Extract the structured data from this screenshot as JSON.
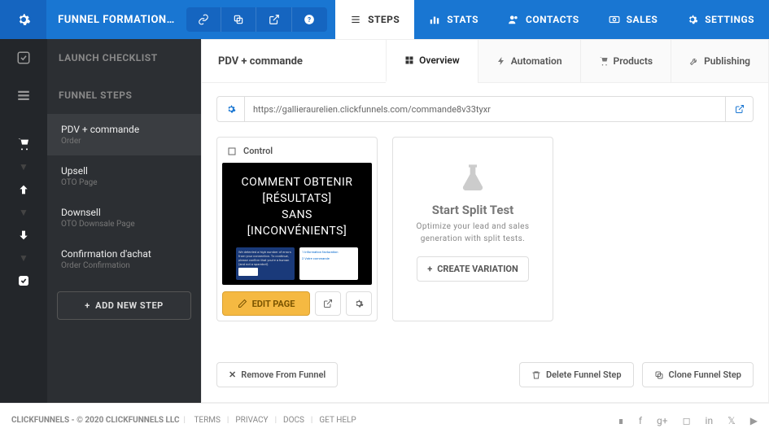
{
  "header": {
    "funnel_name": "FUNNEL FORMATION E…",
    "nav": [
      {
        "key": "steps",
        "label": "STEPS",
        "active": true
      },
      {
        "key": "stats",
        "label": "STATS"
      },
      {
        "key": "contacts",
        "label": "CONTACTS"
      },
      {
        "key": "sales",
        "label": "SALES"
      },
      {
        "key": "settings",
        "label": "SETTINGS"
      }
    ]
  },
  "sidebar": {
    "section_launch": "LAUNCH CHECKLIST",
    "section_steps": "FUNNEL STEPS",
    "steps": [
      {
        "name": "PDV + commande",
        "type": "Order",
        "active": true
      },
      {
        "name": "Upsell",
        "type": "OTO Page"
      },
      {
        "name": "Downsell",
        "type": "OTO Downsale Page"
      },
      {
        "name": "Confirmation d'achat",
        "type": "Order Confirmation"
      }
    ],
    "add_step": "ADD NEW STEP"
  },
  "content": {
    "title": "PDV + commande",
    "subtabs": [
      {
        "key": "overview",
        "label": "Overview",
        "active": true
      },
      {
        "key": "automation",
        "label": "Automation"
      },
      {
        "key": "products",
        "label": "Products"
      },
      {
        "key": "publishing",
        "label": "Publishing"
      }
    ],
    "url": "https://gallieraurelien.clickfunnels.com/commande8v33tyxr",
    "control_card": {
      "header": "Control",
      "preview_line1": "COMMENT OBTENIR",
      "preview_line2": "[RÉSULTATS]",
      "preview_line3": "SANS [INCONVÉNIENTS]",
      "edit_button": "EDIT PAGE"
    },
    "split_test": {
      "title": "Start Split Test",
      "subtitle": "Optimize your lead and sales generation with split tests.",
      "button": "CREATE VARIATION"
    },
    "bottom": {
      "remove": "Remove From Funnel",
      "delete": "Delete Funnel Step",
      "clone": "Clone Funnel Step"
    }
  },
  "footer": {
    "copyright": "CLICKFUNNELS - © 2020 CLICKFUNNELS LLC",
    "links": [
      "TERMS",
      "PRIVACY",
      "DOCS",
      "GET HELP"
    ]
  }
}
